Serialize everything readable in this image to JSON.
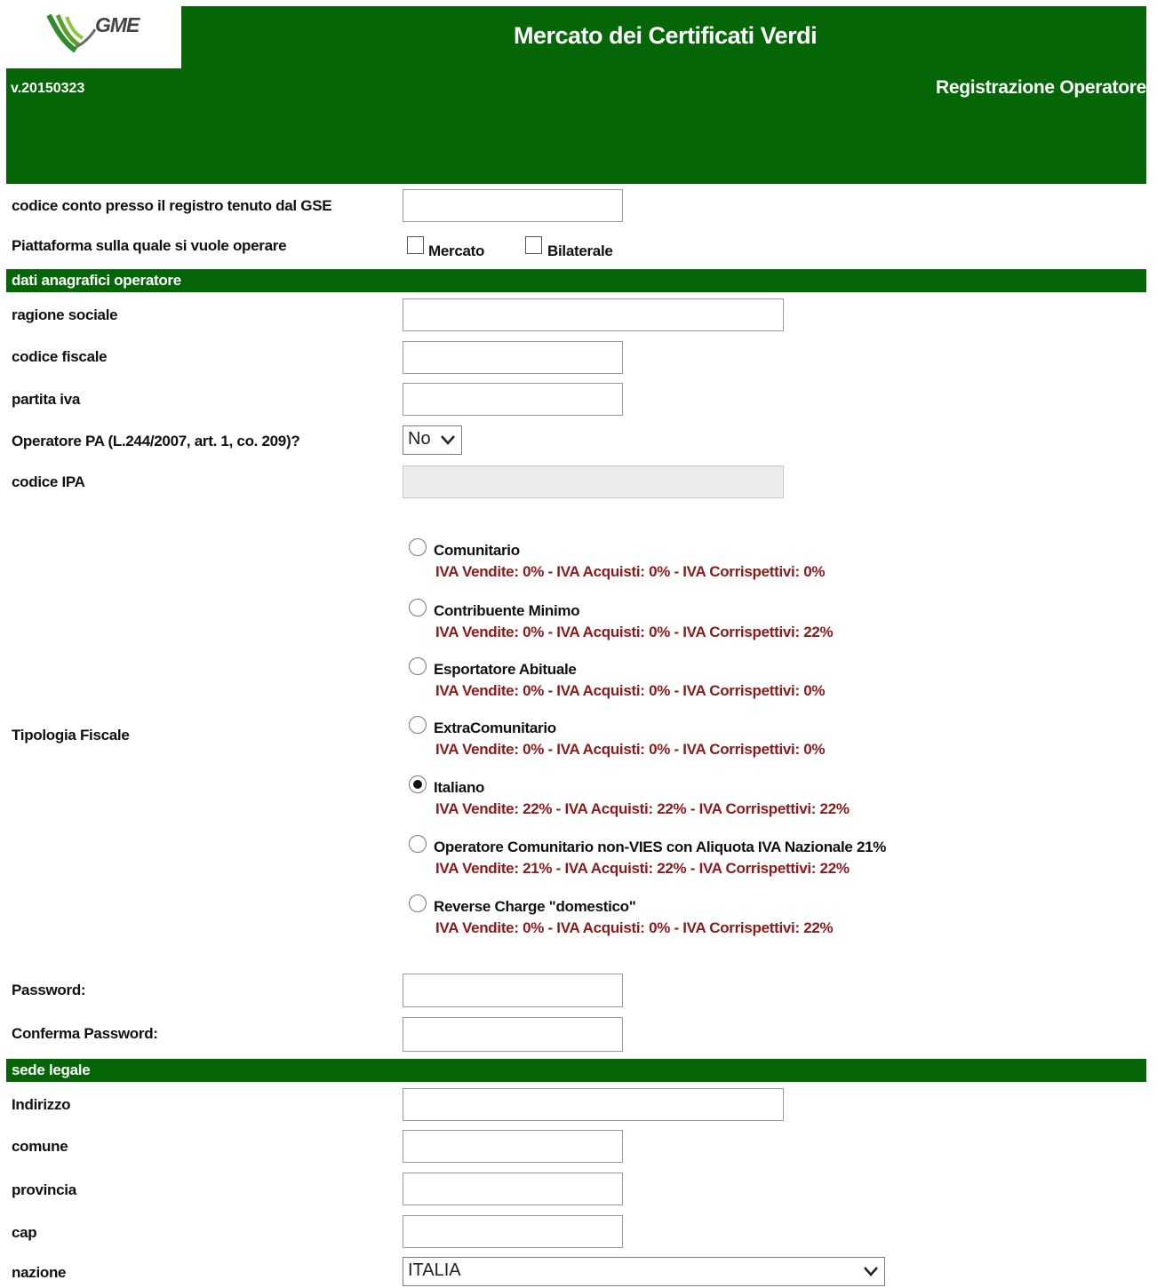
{
  "header": {
    "logo_text": "GME",
    "title": "Mercato dei Certificati Verdi",
    "version": "v.20150323",
    "subtitle": "Registrazione Operatore"
  },
  "colors": {
    "brand_green": "#056607",
    "fiscal_note": "#8b1a1a"
  },
  "form": {
    "codice_conto": {
      "label": "codice conto presso il registro tenuto dal GSE",
      "value": ""
    },
    "piattaforma": {
      "label": "Piattaforma sulla quale si vuole operare",
      "options": [
        {
          "label": "Mercato",
          "checked": false
        },
        {
          "label": "Bilaterale",
          "checked": false
        }
      ]
    }
  },
  "section_anagrafica": {
    "title": "dati anagrafici operatore",
    "ragione_sociale": {
      "label": "ragione sociale",
      "value": ""
    },
    "codice_fiscale": {
      "label": "codice fiscale",
      "value": ""
    },
    "partita_iva": {
      "label": "partita iva",
      "value": ""
    },
    "operatore_pa": {
      "label": "Operatore PA (L.244/2007, art. 1, co. 209)?",
      "selected": "No"
    },
    "codice_ipa": {
      "label": "codice IPA",
      "value": "",
      "disabled": true
    },
    "tipologia_fiscale": {
      "label": "Tipologia Fiscale",
      "options": [
        {
          "label": "Comunitario",
          "note": "IVA Vendite: 0% - IVA Acquisti: 0% - IVA Corrispettivi: 0%",
          "checked": false
        },
        {
          "label": "Contribuente Minimo",
          "note": "IVA Vendite: 0% - IVA Acquisti: 0% - IVA Corrispettivi: 22%",
          "checked": false
        },
        {
          "label": "Esportatore Abituale",
          "note": "IVA Vendite: 0% - IVA Acquisti: 0% - IVA Corrispettivi: 0%",
          "checked": false
        },
        {
          "label": "ExtraComunitario",
          "note": "IVA Vendite: 0% - IVA Acquisti: 0% - IVA Corrispettivi: 0%",
          "checked": false
        },
        {
          "label": "Italiano",
          "note": "IVA Vendite: 22% - IVA Acquisti: 22% - IVA Corrispettivi: 22%",
          "checked": true
        },
        {
          "label": "Operatore Comunitario non-VIES con Aliquota IVA Nazionale 21%",
          "note": "IVA Vendite: 21% - IVA Acquisti: 22% - IVA Corrispettivi: 22%",
          "checked": false
        },
        {
          "label": "Reverse Charge \"domestico\"",
          "note": "IVA Vendite: 0% - IVA Acquisti: 0% - IVA Corrispettivi: 22%",
          "checked": false
        }
      ]
    },
    "password": {
      "label": "Password:",
      "value": ""
    },
    "conferma_password": {
      "label": "Conferma Password:",
      "value": ""
    }
  },
  "section_sede": {
    "title": "sede legale",
    "indirizzo": {
      "label": "Indirizzo",
      "value": ""
    },
    "comune": {
      "label": "comune",
      "value": ""
    },
    "provincia": {
      "label": "provincia",
      "value": ""
    },
    "cap": {
      "label": "cap",
      "value": ""
    },
    "nazione": {
      "label": "nazione",
      "selected": "ITALIA"
    }
  }
}
